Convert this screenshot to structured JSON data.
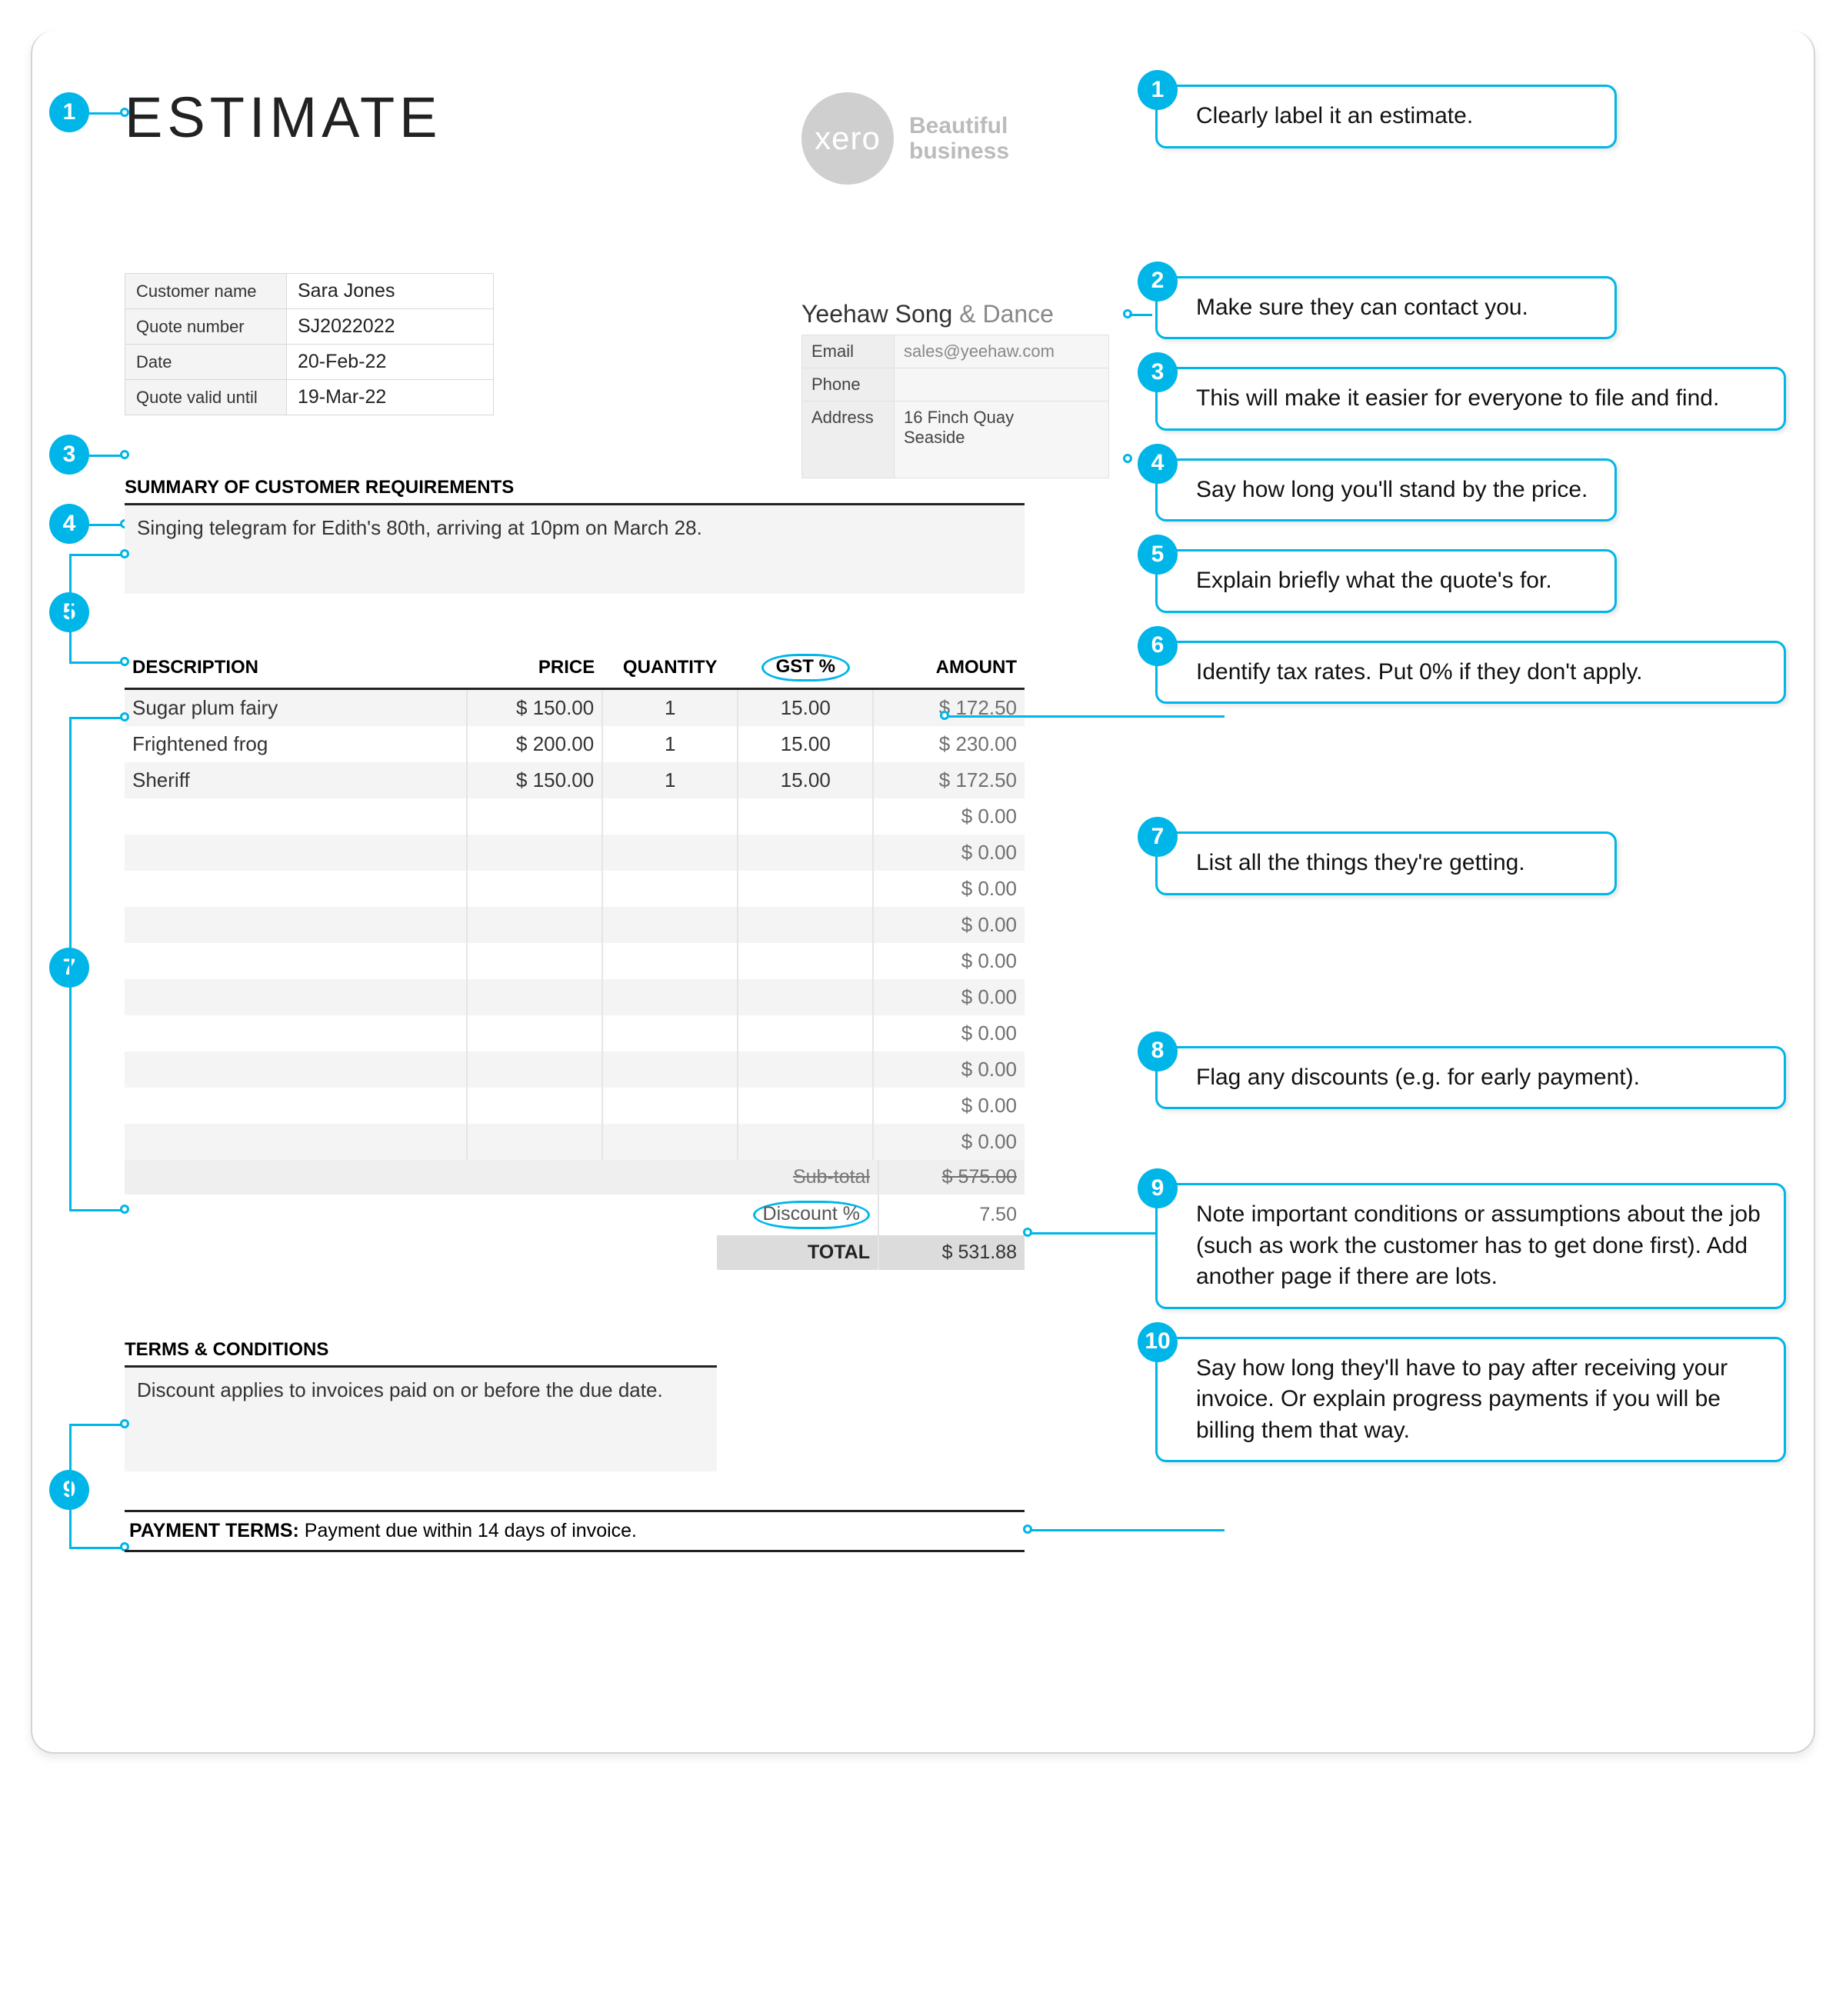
{
  "title": "ESTIMATE",
  "logo": {
    "text": "xero",
    "tagline": "Beautiful business"
  },
  "customer": {
    "labels": {
      "name": "Customer name",
      "number": "Quote number",
      "date": "Date",
      "valid": "Quote valid until"
    },
    "values": {
      "name": "Sara Jones",
      "number": "SJ2022022",
      "date": "20-Feb-22",
      "valid": "19-Mar-22"
    }
  },
  "seller": {
    "name_main": "Yeehaw Song ",
    "name_amp": "& Dance",
    "labels": {
      "email": "Email",
      "phone": "Phone",
      "address": "Address"
    },
    "values": {
      "email": "sales@yeehaw.com",
      "phone": "",
      "address": "16 Finch Quay\nSeaside"
    }
  },
  "summary": {
    "heading": "SUMMARY OF CUSTOMER REQUIREMENTS",
    "text": "Singing telegram for Edith's 80th, arriving at 10pm on March 28."
  },
  "columns": {
    "desc": "DESCRIPTION",
    "price": "PRICE",
    "qty": "QUANTITY",
    "gst": "GST %",
    "amount": "AMOUNT"
  },
  "items": [
    {
      "desc": "Sugar plum fairy",
      "price": "$ 150.00",
      "qty": "1",
      "gst": "15.00",
      "amount": "$ 172.50"
    },
    {
      "desc": "Frightened frog",
      "price": "$ 200.00",
      "qty": "1",
      "gst": "15.00",
      "amount": "$ 230.00"
    },
    {
      "desc": "Sheriff",
      "price": "$ 150.00",
      "qty": "1",
      "gst": "15.00",
      "amount": "$ 172.50"
    },
    {
      "desc": "",
      "price": "",
      "qty": "",
      "gst": "",
      "amount": "$ 0.00"
    },
    {
      "desc": "",
      "price": "",
      "qty": "",
      "gst": "",
      "amount": "$ 0.00"
    },
    {
      "desc": "",
      "price": "",
      "qty": "",
      "gst": "",
      "amount": "$ 0.00"
    },
    {
      "desc": "",
      "price": "",
      "qty": "",
      "gst": "",
      "amount": "$ 0.00"
    },
    {
      "desc": "",
      "price": "",
      "qty": "",
      "gst": "",
      "amount": "$ 0.00"
    },
    {
      "desc": "",
      "price": "",
      "qty": "",
      "gst": "",
      "amount": "$ 0.00"
    },
    {
      "desc": "",
      "price": "",
      "qty": "",
      "gst": "",
      "amount": "$ 0.00"
    },
    {
      "desc": "",
      "price": "",
      "qty": "",
      "gst": "",
      "amount": "$ 0.00"
    },
    {
      "desc": "",
      "price": "",
      "qty": "",
      "gst": "",
      "amount": "$ 0.00"
    },
    {
      "desc": "",
      "price": "",
      "qty": "",
      "gst": "",
      "amount": "$ 0.00"
    }
  ],
  "totals": {
    "subtotal_label": "Sub-total",
    "subtotal_value": "$ 575.00",
    "discount_label": "Discount %",
    "discount_value": "7.50",
    "total_label": "TOTAL",
    "total_value": "$ 531.88"
  },
  "terms": {
    "heading": "TERMS & CONDITIONS",
    "text": "Discount applies to invoices paid on or before the due date."
  },
  "payment": {
    "label": "PAYMENT TERMS:",
    "text": " Payment due within 14 days of invoice."
  },
  "callouts": {
    "c1": "Clearly label it an estimate.",
    "c2": "Make sure they can contact you.",
    "c3": "This will make it easier for everyone to file and find.",
    "c4": "Say how long you'll stand by the price.",
    "c5": "Explain briefly what the quote's for.",
    "c6": "Identify tax rates. Put 0% if they don't apply.",
    "c7": "List all the things they're getting.",
    "c8": "Flag any discounts (e.g. for early payment).",
    "c9": "Note important conditions or assumptions about the job (such as work the customer has to get done first). Add another page if there are lots.",
    "c10": "Say how long they'll have to pay after receiving your invoice. Or explain progress payments if you will be billing them that way."
  },
  "badges": {
    "n1": "1",
    "n2": "2",
    "n3": "3",
    "n4": "4",
    "n5": "5",
    "n6": "6",
    "n7": "7",
    "n8": "8",
    "n9": "9",
    "n10": "10"
  }
}
